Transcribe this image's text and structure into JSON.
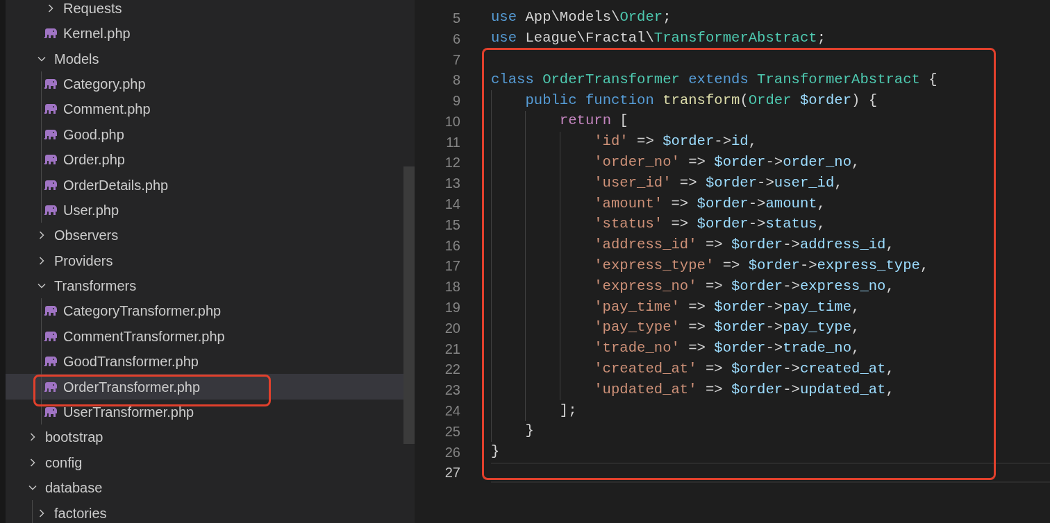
{
  "explorer": {
    "tree": [
      {
        "kind": "hidden",
        "children": [
          {
            "kind": "hidden",
            "children": [
              {
                "kind": "folder",
                "name": "Requests",
                "expanded": false,
                "selected": false
              },
              {
                "kind": "file",
                "name": "Kernel.php",
                "selected": false
              }
            ]
          },
          {
            "kind": "folder",
            "name": "Models",
            "expanded": true,
            "selected": false,
            "children": [
              {
                "kind": "file",
                "name": "Category.php",
                "selected": false
              },
              {
                "kind": "file",
                "name": "Comment.php",
                "selected": false
              },
              {
                "kind": "file",
                "name": "Good.php",
                "selected": false
              },
              {
                "kind": "file",
                "name": "Order.php",
                "selected": false
              },
              {
                "kind": "file",
                "name": "OrderDetails.php",
                "selected": false
              },
              {
                "kind": "file",
                "name": "User.php",
                "selected": false
              }
            ]
          },
          {
            "kind": "folder",
            "name": "Observers",
            "expanded": false,
            "selected": false
          },
          {
            "kind": "folder",
            "name": "Providers",
            "expanded": false,
            "selected": false
          },
          {
            "kind": "folder",
            "name": "Transformers",
            "expanded": true,
            "selected": false,
            "children": [
              {
                "kind": "file",
                "name": "CategoryTransformer.php",
                "selected": false
              },
              {
                "kind": "file",
                "name": "CommentTransformer.php",
                "selected": false
              },
              {
                "kind": "file",
                "name": "GoodTransformer.php",
                "selected": false
              },
              {
                "kind": "file",
                "name": "OrderTransformer.php",
                "selected": true
              },
              {
                "kind": "file",
                "name": "UserTransformer.php",
                "selected": false
              }
            ]
          }
        ]
      },
      {
        "kind": "folder",
        "name": "bootstrap",
        "expanded": false,
        "selected": false
      },
      {
        "kind": "folder",
        "name": "config",
        "expanded": false,
        "selected": false
      },
      {
        "kind": "folder",
        "name": "database",
        "expanded": true,
        "selected": false,
        "children": [
          {
            "kind": "folder",
            "name": "factories",
            "expanded": false,
            "selected": false
          }
        ]
      }
    ]
  },
  "editor": {
    "lines": [
      {
        "number": "5",
        "current": false,
        "tokens": [
          {
            "kind": "keyword",
            "text": "use"
          },
          {
            "kind": "plain",
            "text": " App\\Models\\"
          },
          {
            "kind": "type",
            "text": "Order"
          },
          {
            "kind": "plain",
            "text": ";"
          }
        ]
      },
      {
        "number": "6",
        "current": false,
        "tokens": [
          {
            "kind": "keyword",
            "text": "use"
          },
          {
            "kind": "plain",
            "text": " League\\Fractal\\"
          },
          {
            "kind": "type",
            "text": "TransformerAbstract"
          },
          {
            "kind": "plain",
            "text": ";"
          }
        ]
      },
      {
        "number": "7",
        "current": false
      },
      {
        "number": "8",
        "current": false,
        "tokens": [
          {
            "kind": "keyword",
            "text": "class"
          },
          {
            "kind": "type",
            "text": " OrderTransformer"
          },
          {
            "kind": "keyword",
            "text": " extends"
          },
          {
            "kind": "type",
            "text": " TransformerAbstract"
          },
          {
            "kind": "plain",
            "text": " {"
          }
        ]
      },
      {
        "number": "9",
        "current": false,
        "tokens": [
          {
            "kind": "keyword",
            "text": "    public"
          },
          {
            "kind": "keyword",
            "text": " function"
          },
          {
            "kind": "function",
            "text": " transform"
          },
          {
            "kind": "plain",
            "text": "("
          },
          {
            "kind": "type",
            "text": "Order"
          },
          {
            "kind": "variable",
            "text": " $order"
          },
          {
            "kind": "plain",
            "text": ") {"
          }
        ]
      },
      {
        "number": "10",
        "current": false,
        "tokens": [
          {
            "kind": "control",
            "text": "        return"
          },
          {
            "kind": "plain",
            "text": " ["
          }
        ]
      },
      {
        "number": "11",
        "current": false,
        "tokens": [
          {
            "kind": "string",
            "text": "            'id'"
          },
          {
            "kind": "plain",
            "text": " => "
          },
          {
            "kind": "variable",
            "text": "$order"
          },
          {
            "kind": "plain",
            "text": "->"
          },
          {
            "kind": "variable",
            "text": "id"
          },
          {
            "kind": "plain",
            "text": ","
          }
        ]
      },
      {
        "number": "12",
        "current": false,
        "tokens": [
          {
            "kind": "string",
            "text": "            'order_no'"
          },
          {
            "kind": "plain",
            "text": " => "
          },
          {
            "kind": "variable",
            "text": "$order"
          },
          {
            "kind": "plain",
            "text": "->"
          },
          {
            "kind": "variable",
            "text": "order_no"
          },
          {
            "kind": "plain",
            "text": ","
          }
        ]
      },
      {
        "number": "13",
        "current": false,
        "tokens": [
          {
            "kind": "string",
            "text": "            'user_id'"
          },
          {
            "kind": "plain",
            "text": " => "
          },
          {
            "kind": "variable",
            "text": "$order"
          },
          {
            "kind": "plain",
            "text": "->"
          },
          {
            "kind": "variable",
            "text": "user_id"
          },
          {
            "kind": "plain",
            "text": ","
          }
        ]
      },
      {
        "number": "14",
        "current": false,
        "tokens": [
          {
            "kind": "string",
            "text": "            'amount'"
          },
          {
            "kind": "plain",
            "text": " => "
          },
          {
            "kind": "variable",
            "text": "$order"
          },
          {
            "kind": "plain",
            "text": "->"
          },
          {
            "kind": "variable",
            "text": "amount"
          },
          {
            "kind": "plain",
            "text": ","
          }
        ]
      },
      {
        "number": "15",
        "current": false,
        "tokens": [
          {
            "kind": "string",
            "text": "            'status'"
          },
          {
            "kind": "plain",
            "text": " => "
          },
          {
            "kind": "variable",
            "text": "$order"
          },
          {
            "kind": "plain",
            "text": "->"
          },
          {
            "kind": "variable",
            "text": "status"
          },
          {
            "kind": "plain",
            "text": ","
          }
        ]
      },
      {
        "number": "16",
        "current": false,
        "tokens": [
          {
            "kind": "string",
            "text": "            'address_id'"
          },
          {
            "kind": "plain",
            "text": " => "
          },
          {
            "kind": "variable",
            "text": "$order"
          },
          {
            "kind": "plain",
            "text": "->"
          },
          {
            "kind": "variable",
            "text": "address_id"
          },
          {
            "kind": "plain",
            "text": ","
          }
        ]
      },
      {
        "number": "17",
        "current": false,
        "tokens": [
          {
            "kind": "string",
            "text": "            'express_type'"
          },
          {
            "kind": "plain",
            "text": " => "
          },
          {
            "kind": "variable",
            "text": "$order"
          },
          {
            "kind": "plain",
            "text": "->"
          },
          {
            "kind": "variable",
            "text": "express_type"
          },
          {
            "kind": "plain",
            "text": ","
          }
        ]
      },
      {
        "number": "18",
        "current": false,
        "tokens": [
          {
            "kind": "string",
            "text": "            'express_no'"
          },
          {
            "kind": "plain",
            "text": " => "
          },
          {
            "kind": "variable",
            "text": "$order"
          },
          {
            "kind": "plain",
            "text": "->"
          },
          {
            "kind": "variable",
            "text": "express_no"
          },
          {
            "kind": "plain",
            "text": ","
          }
        ]
      },
      {
        "number": "19",
        "current": false,
        "tokens": [
          {
            "kind": "string",
            "text": "            'pay_time'"
          },
          {
            "kind": "plain",
            "text": " => "
          },
          {
            "kind": "variable",
            "text": "$order"
          },
          {
            "kind": "plain",
            "text": "->"
          },
          {
            "kind": "variable",
            "text": "pay_time"
          },
          {
            "kind": "plain",
            "text": ","
          }
        ]
      },
      {
        "number": "20",
        "current": false,
        "tokens": [
          {
            "kind": "string",
            "text": "            'pay_type'"
          },
          {
            "kind": "plain",
            "text": " => "
          },
          {
            "kind": "variable",
            "text": "$order"
          },
          {
            "kind": "plain",
            "text": "->"
          },
          {
            "kind": "variable",
            "text": "pay_type"
          },
          {
            "kind": "plain",
            "text": ","
          }
        ]
      },
      {
        "number": "21",
        "current": false,
        "tokens": [
          {
            "kind": "string",
            "text": "            'trade_no'"
          },
          {
            "kind": "plain",
            "text": " => "
          },
          {
            "kind": "variable",
            "text": "$order"
          },
          {
            "kind": "plain",
            "text": "->"
          },
          {
            "kind": "variable",
            "text": "trade_no"
          },
          {
            "kind": "plain",
            "text": ","
          }
        ]
      },
      {
        "number": "22",
        "current": false,
        "tokens": [
          {
            "kind": "string",
            "text": "            'created_at'"
          },
          {
            "kind": "plain",
            "text": " => "
          },
          {
            "kind": "variable",
            "text": "$order"
          },
          {
            "kind": "plain",
            "text": "->"
          },
          {
            "kind": "variable",
            "text": "created_at"
          },
          {
            "kind": "plain",
            "text": ","
          }
        ]
      },
      {
        "number": "23",
        "current": false,
        "tokens": [
          {
            "kind": "string",
            "text": "            'updated_at'"
          },
          {
            "kind": "plain",
            "text": " => "
          },
          {
            "kind": "variable",
            "text": "$order"
          },
          {
            "kind": "plain",
            "text": "->"
          },
          {
            "kind": "variable",
            "text": "updated_at"
          },
          {
            "kind": "plain",
            "text": ","
          }
        ]
      },
      {
        "number": "24",
        "current": false,
        "tokens": [
          {
            "kind": "plain",
            "text": "        ];"
          }
        ]
      },
      {
        "number": "25",
        "current": false,
        "tokens": [
          {
            "kind": "plain",
            "text": "    }"
          }
        ]
      },
      {
        "number": "26",
        "current": false,
        "tokens": [
          {
            "kind": "plain",
            "text": "}"
          }
        ]
      },
      {
        "number": "27",
        "current": true
      }
    ]
  }
}
